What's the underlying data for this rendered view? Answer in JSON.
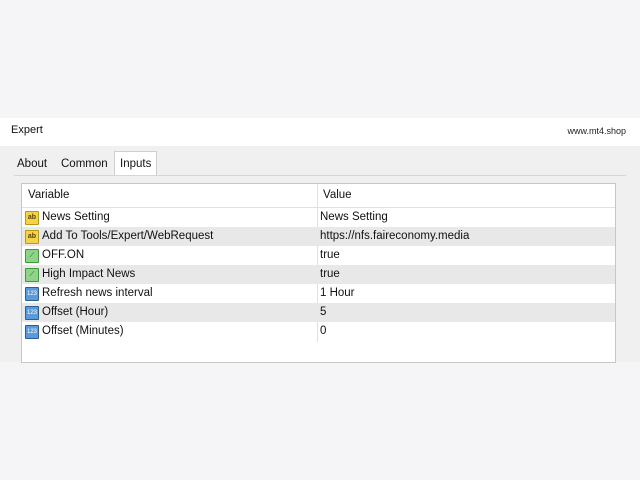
{
  "window": {
    "title": "Expert",
    "site": "www.mt4.shop"
  },
  "tabs": [
    {
      "label": "About"
    },
    {
      "label": "Common"
    },
    {
      "label": "Inputs"
    }
  ],
  "table": {
    "columns": {
      "variable": "Variable",
      "value": "Value"
    },
    "rows": [
      {
        "icon": "ab",
        "variable": "News Setting",
        "value": "News Setting"
      },
      {
        "icon": "ab",
        "variable": "Add To Tools/Expert/WebRequest",
        "value": "https://nfs.faireconomy.media"
      },
      {
        "icon": "bool",
        "variable": "OFF.ON",
        "value": "true"
      },
      {
        "icon": "bool",
        "variable": "High Impact News",
        "value": "true"
      },
      {
        "icon": "num",
        "variable": "Refresh news interval",
        "value": "1 Hour"
      },
      {
        "icon": "num",
        "variable": "Offset (Hour)",
        "value": "5"
      },
      {
        "icon": "num",
        "variable": "Offset (Minutes)",
        "value": "0"
      }
    ]
  }
}
